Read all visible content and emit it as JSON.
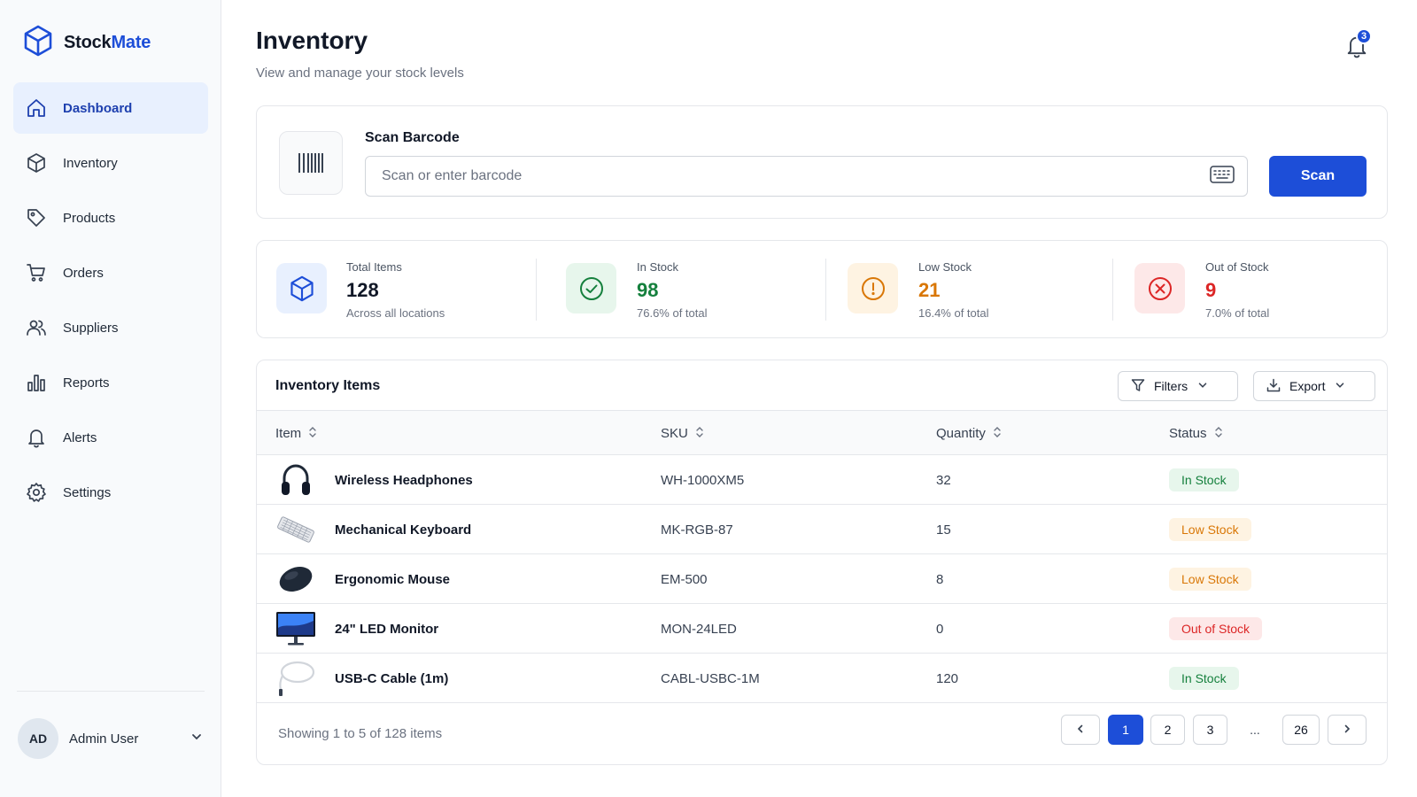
{
  "app": {
    "name_part1": "Stock",
    "name_part2": "Mate",
    "logo_icon": "cube-icon"
  },
  "sidebar": {
    "items": [
      {
        "label": "Dashboard",
        "icon": "home-icon",
        "active": true
      },
      {
        "label": "Inventory",
        "icon": "box-icon"
      },
      {
        "label": "Products",
        "icon": "tag-icon"
      },
      {
        "label": "Orders",
        "icon": "cart-icon"
      },
      {
        "label": "Suppliers",
        "icon": "users-icon"
      },
      {
        "label": "Reports",
        "icon": "bar-chart-icon"
      },
      {
        "label": "Alerts",
        "icon": "bell-icon"
      },
      {
        "label": "Settings",
        "icon": "gear-icon"
      }
    ],
    "user": {
      "initials": "AD",
      "name": "Admin User"
    }
  },
  "header": {
    "title": "Inventory",
    "subtitle": "View and manage your stock levels",
    "notification_count": "3"
  },
  "scan": {
    "label": "Scan Barcode",
    "placeholder": "Scan or enter barcode",
    "value": "",
    "button_label": "Scan"
  },
  "stats": [
    {
      "label": "Total Items",
      "value": "128",
      "sub": "Across all locations",
      "color": "#111827",
      "icon": "cube-icon"
    },
    {
      "label": "In Stock",
      "value": "98",
      "sub": "76.6% of total",
      "color": "#15803d",
      "icon": "check-circle-icon"
    },
    {
      "label": "Low Stock",
      "value": "21",
      "sub": "16.4% of total",
      "color": "#d97706",
      "icon": "alert-circle-icon"
    },
    {
      "label": "Out of Stock",
      "value": "9",
      "sub": "7.0% of total",
      "color": "#dc2626",
      "icon": "x-circle-icon"
    }
  ],
  "table": {
    "title": "Inventory Items",
    "filters_label": "Filters",
    "export_label": "Export",
    "columns": [
      "Item",
      "SKU",
      "Quantity",
      "Status"
    ],
    "rows": [
      {
        "name": "Wireless Headphones",
        "sku": "WH-1000XM5",
        "quantity": "32",
        "status": "In Stock",
        "thumb": "headphones-icon"
      },
      {
        "name": "Mechanical Keyboard",
        "sku": "MK-RGB-87",
        "quantity": "15",
        "status": "Low Stock",
        "thumb": "keyboard-icon"
      },
      {
        "name": "Ergonomic Mouse",
        "sku": "EM-500",
        "quantity": "8",
        "status": "Low Stock",
        "thumb": "mouse-icon"
      },
      {
        "name": "24\" LED Monitor",
        "sku": "MON-24LED",
        "quantity": "0",
        "status": "Out of Stock",
        "thumb": "monitor-icon"
      },
      {
        "name": "USB-C Cable (1m)",
        "sku": "CABL-USBC-1M",
        "quantity": "120",
        "status": "In Stock",
        "thumb": "cable-icon"
      }
    ],
    "footer": "Showing 1 to 5 of 128 items",
    "pagination": {
      "pages": [
        "1",
        "2",
        "3"
      ],
      "ellipsis": "...",
      "last": "26",
      "current": "1"
    }
  },
  "colors": {
    "accent": "#1d4ed8",
    "in_stock": "#15803d",
    "low_stock": "#d97706",
    "out_of_stock": "#dc2626"
  }
}
